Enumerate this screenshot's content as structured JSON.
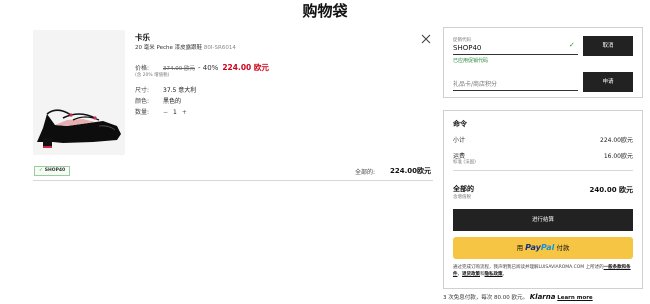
{
  "page": {
    "title": "购物袋"
  },
  "product": {
    "brand": "卡乐",
    "name": "20 毫米 Peche 漆皮露跟鞋",
    "code": "80I-SR6014",
    "price_label": "价格:",
    "original_price": "374.00 欧元",
    "discount": "- 40%",
    "new_price": "224.00 欧元",
    "vat_note": "(含 20% 增值税)",
    "size_label": "尺寸:",
    "size_value": "37.5 意大利",
    "color_label": "颜色:",
    "color_value": "黑色的",
    "qty_label": "数量:",
    "qty_minus": "−",
    "qty_value": "1",
    "qty_plus": "+",
    "coupon_tag": "SHOP40",
    "total_label": "全部的:",
    "total_value": "224.00欧元"
  },
  "promo": {
    "code_label": "促销代码",
    "code_value": "SHOP40",
    "cancel_button": "取消",
    "applied_msg": "已应用促销代码",
    "gift_placeholder": "礼品卡/商店积分",
    "apply_button": "申请"
  },
  "order": {
    "title": "命令",
    "subtotal_label": "小计",
    "subtotal_value": "224.00欧元",
    "shipping_label": "运费",
    "shipping_sub": "标准 (法国)",
    "shipping_value": "16.00欧元",
    "total_label": "全部的",
    "total_sub": "含增值税",
    "total_value": "240.00 欧元",
    "checkout_button": "进行结算",
    "paypal_prefix": "用",
    "paypal_brand_a": "Pay",
    "paypal_brand_b": "Pal",
    "paypal_suffix": "付款",
    "terms_text": "通过完成订购流程，我声明我已阅读并理解LUISAVIAROMA.COM 上所述的",
    "terms_link1": "一般条款和条件",
    "terms_mid": "，",
    "terms_link2": "退货政策",
    "terms_and": "和",
    "terms_link3": "隐私政策",
    "terms_end": "。"
  },
  "klarna": {
    "text": "3 次免息付款，每次 80.00 欧元。",
    "brand": "Klarna",
    "learn_more": "Learn more"
  }
}
